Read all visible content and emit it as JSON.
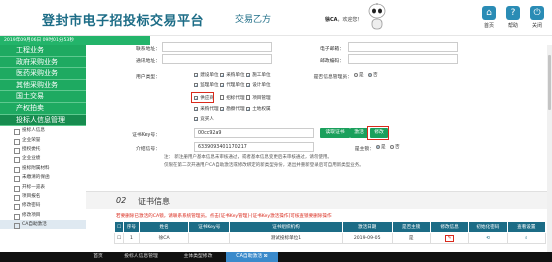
{
  "header": {
    "title": "登封市电子招投标交易平台",
    "role": "交易乙方",
    "user_name": "徐CA",
    "user_greeting": "，欢迎您！",
    "buttons": [
      {
        "label": "首页",
        "icon": "home-icon"
      },
      {
        "label": "帮助",
        "icon": "help-icon"
      },
      {
        "label": "关闭",
        "icon": "power-icon"
      }
    ]
  },
  "sidebar": {
    "date": "2019年09月06日 09时01分53秒",
    "groups": [
      "工程业务",
      "政府采购业务",
      "医药采购业务",
      "其他采购业务",
      "国土交易",
      "产权拍卖",
      "投标人信息管理"
    ],
    "subitems": [
      "投标人信息",
      "企业荣誉",
      "授权委托",
      "企业业绩",
      "投标附属材料",
      "未缴清的保函",
      "开标一览表",
      "项目报名",
      "修改密码",
      "修改项目",
      "CA自助激活"
    ]
  },
  "form": {
    "labels": {
      "contact_addr": "联系地址：",
      "phone": "电子邮箱：",
      "postal": "通讯地址：",
      "postcode": "邮政编码：",
      "user_type": "用户类型：",
      "cert_type": "是否信息管理员：",
      "cert_key": "证书Key号：",
      "intro_no": "介绍信号：",
      "main_key": "是主锁：",
      "fax": "传真号码："
    },
    "types": [
      "建设单位",
      "采购单位",
      "施工单位",
      "监理单位",
      "代理单位",
      "设计单位",
      "供应商",
      "招标代理",
      "项目管理",
      "采购代理",
      "勘察代理",
      "土地权属",
      "竞买人"
    ],
    "radio": {
      "yes": "是",
      "no": "否"
    },
    "cert_key_value": "00cc92a9",
    "intro_value": "6339093401170217",
    "buttons": {
      "read": "读取证书",
      "activate": "激活",
      "modify": "修改"
    },
    "notes": [
      "注：  新注册用户基本信息未审核通过，或者基本信息变更后未审核通过，请勿使用。",
      "    仅限在第二次开通用户CA自助激活或修改绑定的新类型身份，退出并重新登录后可自用新类型业务。"
    ]
  },
  "cert_section": {
    "num": "02",
    "title": "证书信息",
    "warning": "若要删除已激活的CA锁，请联系系统管理员。点击[证书Key管理]-[证书Key激活操作]可核查锁要删除操作",
    "columns": [
      "序号",
      "姓名",
      "证书Key号",
      "证书组织机构",
      "激活日期",
      "是否主锁",
      "修改信息",
      "初始化密码",
      "查看设置"
    ],
    "rows": [
      {
        "no": "1",
        "name": "徐CA",
        "org": "测试投标单位1",
        "date": "2019-09-05",
        "main": "是"
      }
    ]
  },
  "tabs": [
    "首页",
    "投标人信息管理",
    "主体类型修改",
    "CA自助激活"
  ],
  "colors": {
    "brand": "#1c6c86",
    "green": "#1eaa61",
    "red": "#d92a1c"
  }
}
